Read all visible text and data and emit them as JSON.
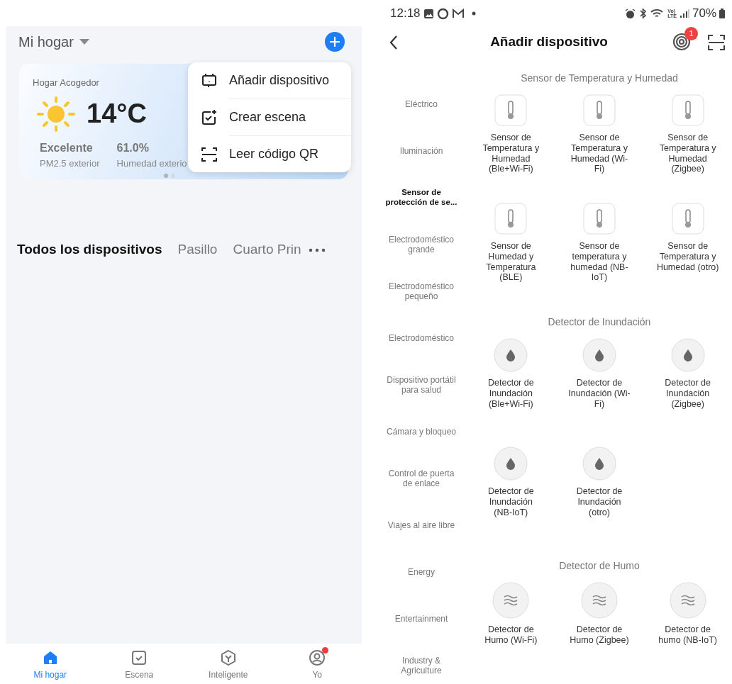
{
  "home": {
    "title": "Mi hogar",
    "weather": {
      "title": "Hogar Acogedor",
      "temperature": "14°C",
      "stats": [
        {
          "value": "Excelente",
          "label": "PM2.5 exterior"
        },
        {
          "value": "61.0%",
          "label": "Humedad exterio"
        }
      ],
      "pages": [
        {
          "selected": true
        },
        {
          "selected": false
        }
      ]
    },
    "add_menu": [
      {
        "kind": "device",
        "label": "Añadir dispositivo"
      },
      {
        "kind": "scene",
        "label": "Crear escena"
      },
      {
        "kind": "qr",
        "label": "Leer código QR"
      }
    ],
    "room_tabs": [
      {
        "label": "Todos los dispositivos",
        "selected": true
      },
      {
        "label": "Pasillo",
        "selected": false
      },
      {
        "label": "Cuarto Prin",
        "selected": false
      }
    ],
    "bottom_nav": [
      {
        "kind": "home",
        "label": "Mi hogar",
        "selected": true,
        "notification": false
      },
      {
        "kind": "scene",
        "label": "Escena",
        "selected": false,
        "notification": false
      },
      {
        "kind": "smart",
        "label": "Inteligente",
        "selected": false,
        "notification": false
      },
      {
        "kind": "profile",
        "label": "Yo",
        "selected": false,
        "notification": true
      }
    ]
  },
  "add_device": {
    "status_bar": {
      "time": "12:18",
      "network": [
        "Vo)",
        "LTE"
      ],
      "battery": "70%"
    },
    "title": "Añadir dispositivo",
    "notification_count": "1",
    "categories": [
      {
        "label": "Eléctrico",
        "selected": false
      },
      {
        "label": "Iluminación",
        "selected": false
      },
      {
        "label": "Sensor de protección de se...",
        "selected": true
      },
      {
        "label": "Electrodoméstico grande",
        "selected": false
      },
      {
        "label": "Electrodoméstico pequeño",
        "selected": false
      },
      {
        "label": "Electrodoméstico",
        "selected": false
      },
      {
        "label": "Dispositivo portátil para salud",
        "selected": false
      },
      {
        "label": "Cámara y bloqueo",
        "selected": false
      },
      {
        "label": "Control de puerta de enlace",
        "selected": false
      },
      {
        "label": "Viajes al aire libre",
        "selected": false
      },
      {
        "label": "Energy",
        "selected": false
      },
      {
        "label": "Entertainment",
        "selected": false
      },
      {
        "label": "Industry & Agriculture",
        "selected": false
      }
    ],
    "sections": [
      {
        "title": "Sensor de Temperatura y Humedad",
        "devices": [
          {
            "kind": "thermometer",
            "name": "Sensor de Temperatura y Humedad (Ble+Wi-Fi)"
          },
          {
            "kind": "thermometer",
            "name": "Sensor de Temperatura y Humedad (Wi-Fi)"
          },
          {
            "kind": "thermometer",
            "name": "Sensor de Temperatura y Humedad (Zigbee)"
          },
          {
            "kind": "thermometer",
            "name": "Sensor de Humedad y Temperatura (BLE)"
          },
          {
            "kind": "thermometer",
            "name": "Sensor de temperatura y humedad (NB-IoT)"
          },
          {
            "kind": "thermometer",
            "name": "Sensor de Temperatura y Humedad (otro)"
          }
        ]
      },
      {
        "title": "Detector de Inundación",
        "devices": [
          {
            "kind": "water",
            "name": "Detector de Inundación (Ble+Wi-Fi)"
          },
          {
            "kind": "water",
            "name": "Detector de Inundación (Wi-Fi)"
          },
          {
            "kind": "water",
            "name": "Detector de Inundación (Zigbee)"
          },
          {
            "kind": "water",
            "name": "Detector de Inundación (NB-IoT)"
          },
          {
            "kind": "water",
            "name": "Detector de Inundación (otro)"
          }
        ]
      },
      {
        "title": "Detector de Humo",
        "devices": [
          {
            "kind": "smoke",
            "name": "Detector de Humo (Wi-Fi)"
          },
          {
            "kind": "smoke",
            "name": "Detector de Humo (Zigbee)"
          },
          {
            "kind": "smoke",
            "name": "Detector de humo (NB-IoT)"
          }
        ]
      }
    ]
  }
}
